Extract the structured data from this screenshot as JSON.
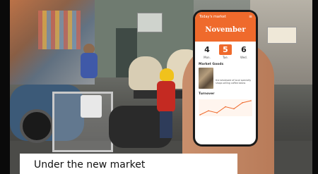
{
  "phone_app": {
    "header_title": "Today's market",
    "menu_icon": "menu-icon",
    "month": "November",
    "dates": [
      {
        "day": "4",
        "label": "Mon."
      },
      {
        "day": "5",
        "label": "Tue.",
        "active": true
      },
      {
        "day": "6",
        "label": "Wed."
      }
    ],
    "goods_label": "Market Goods",
    "goods_text": "the wholesale of local specialty shops selling coffee beans",
    "turnover_label": "Turnover",
    "accent_color": "#ef6a2c",
    "chart_data": {
      "type": "line",
      "values": [
        2,
        4,
        3,
        6,
        5,
        8,
        9
      ]
    }
  },
  "caption": {
    "text": "Under the new market"
  }
}
